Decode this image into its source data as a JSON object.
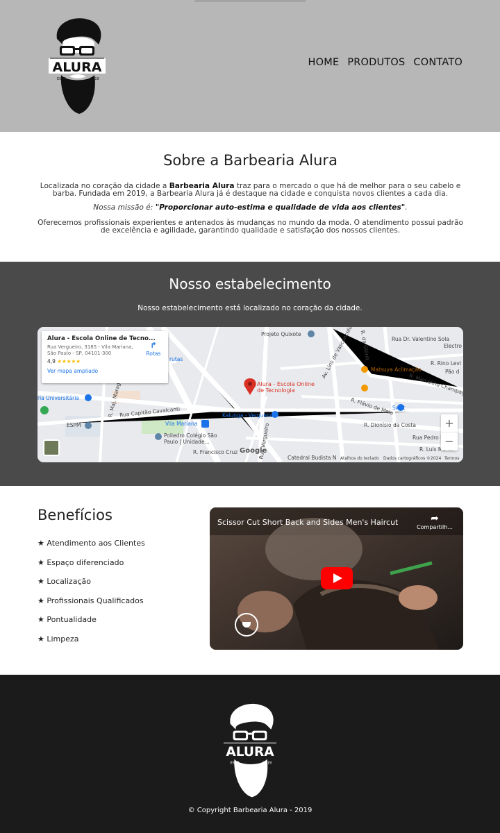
{
  "header": {
    "logo": {
      "brand": "ALURA",
      "est": "ESTD",
      "year": "2019"
    },
    "nav": {
      "home": "HOME",
      "produtos": "PRODUTOS",
      "contato": "CONTATO"
    }
  },
  "about": {
    "title": "Sobre a Barbearia Alura",
    "p1_before": "Localizada no coração da cidade a ",
    "p1_bold": "Barbearia Alura",
    "p1_after": " traz para o mercado o que há de melhor para o seu cabelo e barba. Fundada em 2019, a Barbearia Alura já é destaque na cidade e conquista novos clientes a cada dia.",
    "mission_label": "Nossa missão é: ",
    "mission_quote": "\"Proporcionar auto-estima e qualidade de vida aos clientes\"",
    "mission_end": ".",
    "p3": "Oferecemos profissionais experientes e antenados às mudanças no mundo da moda. O atendimento possui padrão de excelência e agilidade, garantindo qualidade e satisfação dos nossos clientes."
  },
  "establishment": {
    "title": "Nosso estabelecimento",
    "subtitle": "Nosso estabelecimento está localizado no coração da cidade.",
    "map": {
      "card_title": "Alura - Escola Online de Tecno...",
      "card_address": "Rua Vergueiro, 3185 - Vila Mariana, São Paulo - SP, 04101-300",
      "card_rating": "4,9",
      "card_stars": "★★★★★",
      "card_link": "Ver mapa ampliado",
      "directions": "Rotas",
      "pin_label": "Alura - Escola Online de Tecnologia",
      "zoom_in": "+",
      "zoom_out": "−",
      "google": "Google",
      "shortcuts": "Atalhos do teclado",
      "data": "Dados cartográficos ©2024",
      "terms": "Termos",
      "labels": {
        "projeto": "Projeto Quixote",
        "valentino": "Rua Dr. Valentino Sola",
        "electro": "Electro",
        "rino": "R. Rino Levi",
        "matsuya": "Matsuya Aclimação",
        "marcelino": "R. Marcelino Champagnat",
        "pao": "Pão d",
        "flavio": "R. Flávio de Melo",
        "swift": "Swift",
        "dionisio": "R. Dionísio da Costa",
        "pedro": "Rua Pedro Pomp",
        "luis": "R. Luís Morim",
        "catedral": "Catedral Budista N",
        "francisco": "R. Francisco Cruz",
        "kalunga": "Kalunga - Vergueiro",
        "vila": "Vila Mariana",
        "poliedro": "Poliedro Colégio São Paulo | Unidade...",
        "espm": "ESPM",
        "capitao": "Rua Capitão Cavalcanti",
        "universitaria": "ria Universitária",
        "frutas": "rutas",
        "gloria": "R. da Glória",
        "vasconcelos": "Av. Lins de Vasconcelos",
        "vergueiro_rua": "Rua Vergueiro",
        "maj": "R. Maj. Maragliano"
      }
    }
  },
  "benefits": {
    "title": "Benefícios",
    "items": [
      "★ Atendimento aos Clientes",
      "★ Espaço diferenciado",
      "★ Localização",
      "★ Profissionais Qualificados",
      "★ Pontualidade",
      "★ Limpeza"
    ],
    "video": {
      "title": "Scissor Cut Short Back and Sides Men's Haircut",
      "share": "Compartilh..."
    }
  },
  "footer": {
    "logo": {
      "brand": "ALURA",
      "est": "ESTD",
      "year": "2019"
    },
    "copyright": "© Copyright Barbearia Alura - 2019"
  },
  "colors": {
    "header_bg": "#b7b7b7",
    "establishment_bg": "#4a4a4a",
    "footer_bg": "#1b1b1b",
    "youtube_red": "#ff0000",
    "map_link": "#1a73e8",
    "map_pin": "#d93025"
  }
}
